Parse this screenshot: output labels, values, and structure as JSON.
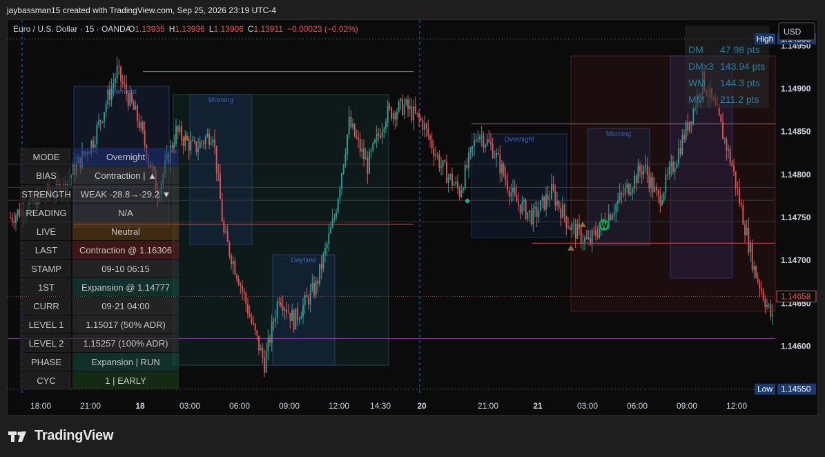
{
  "header": {
    "attribution": "jaybassman15 created with TradingView.com, Sep 25, 2026 23:19 UTC-4"
  },
  "footer": {
    "brand": "TradingView",
    "logo_icon": "tradingview-logo-icon"
  },
  "legend": {
    "symbol": "Euro / U.S. Dollar · 15 · OANDA",
    "o_label": "O",
    "o": "1.13935",
    "h_label": "H",
    "h": "1.13936",
    "l_label": "L",
    "l": "1.13906",
    "c_label": "C",
    "c": "1.13911",
    "change": "−0.00023 (−0.02%)"
  },
  "currency_button": "USD",
  "colors": {
    "up": "#26a69a",
    "down": "#ef5350",
    "pane": "#0b0b0b",
    "axis_text": "#d1d4dc",
    "accent_blue": "#1c3a6e"
  },
  "stats": [
    {
      "k": "DM",
      "v": "47.98 pts"
    },
    {
      "k": "DMx3",
      "v": "143.94 pts"
    },
    {
      "k": "WM",
      "v": "144.3 pts"
    },
    {
      "k": "MM",
      "v": "211.2 pts"
    }
  ],
  "info_table": [
    {
      "k": "MODE",
      "v": "Overnight"
    },
    {
      "k": "BIAS",
      "v": "Contraction | ▲"
    },
    {
      "k": "STRENGTH",
      "v": "WEAK -28.8→-29.2 ▼"
    },
    {
      "k": "READING",
      "v": "N/A"
    },
    {
      "k": "LIVE",
      "v": "Neutral"
    },
    {
      "k": "LAST",
      "v": "Contraction @ 1.16306"
    },
    {
      "k": "STAMP",
      "v": "09-10 06:15"
    },
    {
      "k": "1ST",
      "v": "Expansion @ 1.14777"
    },
    {
      "k": "CURR",
      "v": "09-21 04:00"
    },
    {
      "k": "LEVEL 1",
      "v": "1.15017  (50% ADR)"
    },
    {
      "k": "LEVEL 2",
      "v": "1.15257  (100% ADR)"
    },
    {
      "k": "PHASE",
      "v": "Expansion | RUN"
    },
    {
      "k": "CYC",
      "v": "1 | EARLY"
    }
  ],
  "session_labels": [
    "Overnight",
    "Morning",
    "Daytime",
    "Overnight",
    "Morning"
  ],
  "marker_w": "W",
  "chart_data": {
    "type": "candlestick",
    "ylim": [
      1.1452,
      1.1498
    ],
    "y_ticks": [
      "1.14600",
      "1.14650",
      "1.14700",
      "1.14750",
      "1.14800",
      "1.14850",
      "1.14900",
      "1.14950"
    ],
    "x_ticks": [
      "18:00",
      "21:00",
      "18",
      "03:00",
      "06:00",
      "09:00",
      "12:00",
      "14:30",
      "20",
      "21:00",
      "21",
      "03:00",
      "06:00",
      "09:00",
      "12:00"
    ],
    "high_label": "High",
    "high": "1.14958",
    "low_label": "Low",
    "low": "1.14550",
    "last_price": "1.14658",
    "levels": [
      {
        "price": 1.1492,
        "color": "#7cb342"
      },
      {
        "price": 1.14859,
        "color": "#7cb342"
      },
      {
        "price": 1.14742,
        "color": "#ef5350"
      },
      {
        "price": 1.1472,
        "color": "#ef5350"
      },
      {
        "price": 1.14609,
        "color": "#ab47bc"
      }
    ],
    "anchors": [
      [
        0,
        1.1475
      ],
      [
        14,
        1.1477
      ],
      [
        30,
        1.1479
      ],
      [
        45,
        1.1484
      ],
      [
        58,
        1.1492
      ],
      [
        70,
        1.1486
      ],
      [
        80,
        1.1478
      ],
      [
        90,
        1.1485
      ],
      [
        100,
        1.1483
      ],
      [
        110,
        1.1485
      ],
      [
        116,
        1.1473
      ],
      [
        124,
        1.1468
      ],
      [
        132,
        1.1462
      ],
      [
        138,
        1.1458
      ],
      [
        146,
        1.1466
      ],
      [
        154,
        1.1463
      ],
      [
        166,
        1.1467
      ],
      [
        176,
        1.1475
      ],
      [
        184,
        1.1486
      ],
      [
        194,
        1.1481
      ],
      [
        204,
        1.1487
      ],
      [
        214,
        1.1488
      ],
      [
        224,
        1.1486
      ],
      [
        234,
        1.1481
      ],
      [
        244,
        1.1478
      ],
      [
        254,
        1.1485
      ],
      [
        262,
        1.1483
      ],
      [
        274,
        1.1477
      ],
      [
        284,
        1.1475
      ],
      [
        294,
        1.1478
      ],
      [
        304,
        1.1474
      ],
      [
        314,
        1.1472
      ],
      [
        324,
        1.1475
      ],
      [
        334,
        1.1478
      ],
      [
        344,
        1.1481
      ],
      [
        352,
        1.1477
      ],
      [
        360,
        1.1481
      ],
      [
        370,
        1.1487
      ],
      [
        376,
        1.1491
      ],
      [
        384,
        1.1487
      ],
      [
        392,
        1.1481
      ],
      [
        404,
        1.1469
      ],
      [
        414,
        1.1463
      ]
    ]
  }
}
